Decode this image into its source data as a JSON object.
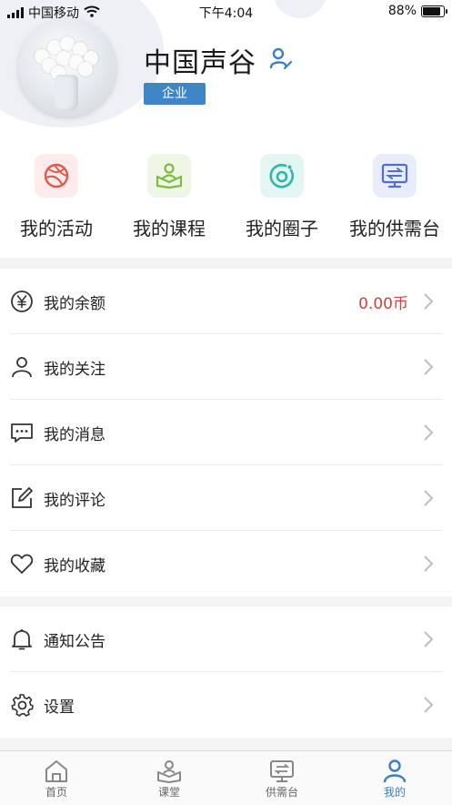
{
  "status_bar": {
    "carrier": "中国移动",
    "time": "下午4:04",
    "battery": "88%"
  },
  "profile": {
    "name": "中国声谷",
    "badge": "企业"
  },
  "quick_actions": [
    {
      "label": "我的活动",
      "icon": "basketball-icon",
      "color": "#e2594a",
      "bg": "#fdeceb"
    },
    {
      "label": "我的课程",
      "icon": "course-icon",
      "color": "#7cbb3f",
      "bg": "#eef6e6"
    },
    {
      "label": "我的圈子",
      "icon": "circle-icon",
      "color": "#2fb7a6",
      "bg": "#e4f6f3"
    },
    {
      "label": "我的供需台",
      "icon": "monitor-icon",
      "color": "#4f6fd0",
      "bg": "#e9edfb"
    }
  ],
  "menu_main": [
    {
      "label": "我的余额",
      "value": "0.00币",
      "icon": "yen-icon"
    },
    {
      "label": "我的关注",
      "icon": "person-icon"
    },
    {
      "label": "我的消息",
      "icon": "message-icon"
    },
    {
      "label": "我的评论",
      "icon": "edit-note-icon"
    },
    {
      "label": "我的收藏",
      "icon": "heart-icon"
    }
  ],
  "menu_secondary": [
    {
      "label": "通知公告",
      "icon": "bell-icon"
    },
    {
      "label": "设置",
      "icon": "gear-icon"
    }
  ],
  "tabs": [
    {
      "label": "首页",
      "icon": "home-icon"
    },
    {
      "label": "课堂",
      "icon": "classroom-icon"
    },
    {
      "label": "供需台",
      "icon": "monitor-icon"
    },
    {
      "label": "我的",
      "icon": "person-icon",
      "active": true
    }
  ],
  "colors": {
    "accent": "#3a7fc4",
    "balance": "#d2423b"
  }
}
